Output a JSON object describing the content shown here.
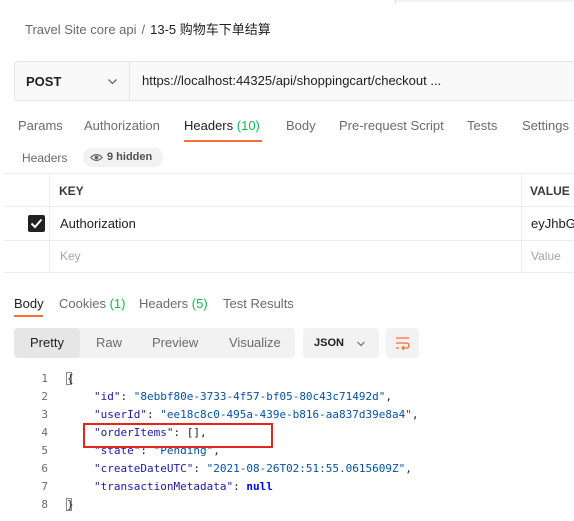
{
  "breadcrumb": {
    "collection": "Travel Site core api",
    "separator": "/",
    "request": "13-5 购物车下单结算"
  },
  "request": {
    "method": "POST",
    "url": "https://localhost:44325/api/shoppingcart/checkout ..."
  },
  "request_tabs": [
    {
      "label": "Params",
      "count": ""
    },
    {
      "label": "Authorization",
      "count": ""
    },
    {
      "label": "Headers",
      "count": "(10)"
    },
    {
      "label": "Body",
      "count": ""
    },
    {
      "label": "Pre-request Script",
      "count": ""
    },
    {
      "label": "Tests",
      "count": ""
    },
    {
      "label": "Settings",
      "count": ""
    }
  ],
  "headers_section": {
    "title": "Headers",
    "hidden_label": "9 hidden"
  },
  "headers_table": {
    "columns": [
      "KEY",
      "VALUE"
    ],
    "rows": [
      {
        "key": "Authorization",
        "value": "eyJhbG",
        "checked": true
      }
    ],
    "placeholder": {
      "key": "Key",
      "value": "Value"
    }
  },
  "response_tabs": [
    {
      "label": "Body",
      "count": ""
    },
    {
      "label": "Cookies",
      "count": "(1)"
    },
    {
      "label": "Headers",
      "count": "(5)"
    },
    {
      "label": "Test Results",
      "count": ""
    }
  ],
  "view_modes": [
    "Pretty",
    "Raw",
    "Preview",
    "Visualize"
  ],
  "format": "JSON",
  "code_lines": [
    {
      "n": "1",
      "text": "{"
    },
    {
      "n": "2",
      "key": "\"id\"",
      "sep": ": ",
      "val": "\"8ebbf80e-3733-4f57-bf05-80c43c71492d\"",
      "end": ","
    },
    {
      "n": "3",
      "key": "\"userId\"",
      "sep": ": ",
      "val": "\"ee18c8c0-495a-439e-b816-aa837d39e8a4\"",
      "end": ","
    },
    {
      "n": "4",
      "key": "\"orderItems\"",
      "sep": ": ",
      "val": "[]",
      "end": ","
    },
    {
      "n": "5",
      "key": "\"state\"",
      "sep": ": ",
      "val": "\"Pending\"",
      "end": ","
    },
    {
      "n": "6",
      "key": "\"createDateUTC\"",
      "sep": ": ",
      "val": "\"2021-08-26T02:51:55.0615609Z\"",
      "end": ","
    },
    {
      "n": "7",
      "key": "\"transactionMetadata\"",
      "sep": ": ",
      "val": "null",
      "end": ""
    },
    {
      "n": "8",
      "text": "}"
    }
  ],
  "colors": {
    "accent": "#ff6c37",
    "count_green": "#0cbb52",
    "highlight_box": "#e0261d"
  }
}
